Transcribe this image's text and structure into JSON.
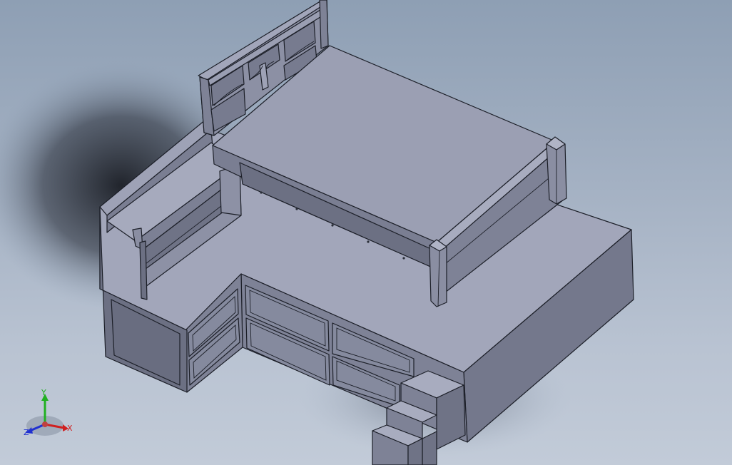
{
  "viewport": {
    "background_top": "#8e9fb4",
    "background_bottom": "#c2cbd8",
    "model_face_light": "#a3a7bc",
    "model_face_mid": "#8a8ea3",
    "model_face_dark": "#6f7386",
    "edge_color": "#1c1f28"
  },
  "triad": {
    "x_label": "X",
    "y_label": "Y",
    "z_label": "Z",
    "x_color": "#d02020",
    "y_color": "#20b020",
    "z_color": "#2030d0"
  }
}
